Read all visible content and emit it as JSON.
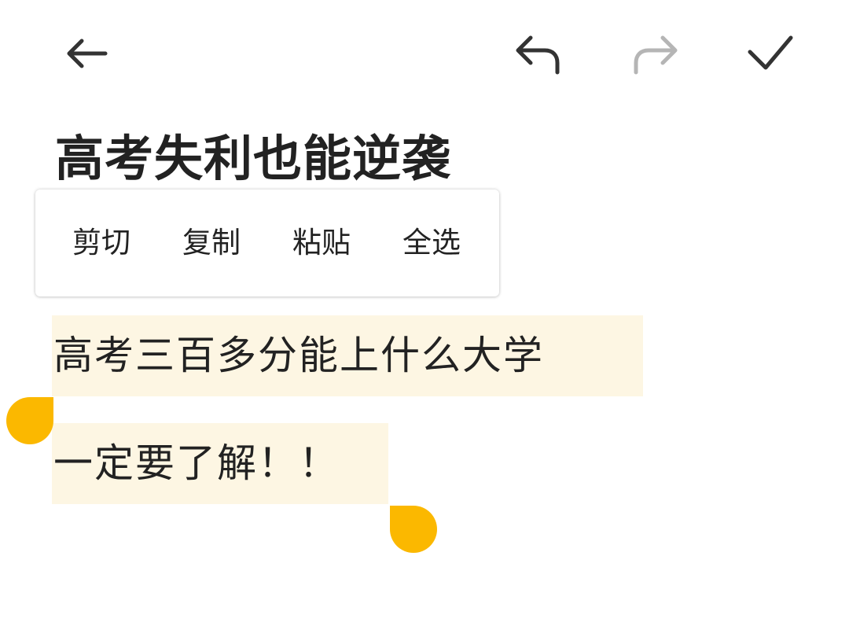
{
  "toolbar": {
    "back_icon": "arrow-left-icon",
    "undo_icon": "undo-icon",
    "redo_icon": "redo-icon",
    "done_icon": "checkmark-icon",
    "redo_enabled": false,
    "icon_color": "#333333",
    "icon_disabled_color": "#b5b5b5"
  },
  "note": {
    "title": "高考失利也能逆袭",
    "body_lines": [
      "高考三百多分能上什么大学",
      "一定要了解！！"
    ]
  },
  "context_menu": {
    "items": [
      {
        "label": "剪切"
      },
      {
        "label": "复制"
      },
      {
        "label": "粘贴"
      },
      {
        "label": "全选"
      }
    ]
  },
  "selection": {
    "highlight_color": "#fdf6e3",
    "handle_color": "#fbb800"
  }
}
